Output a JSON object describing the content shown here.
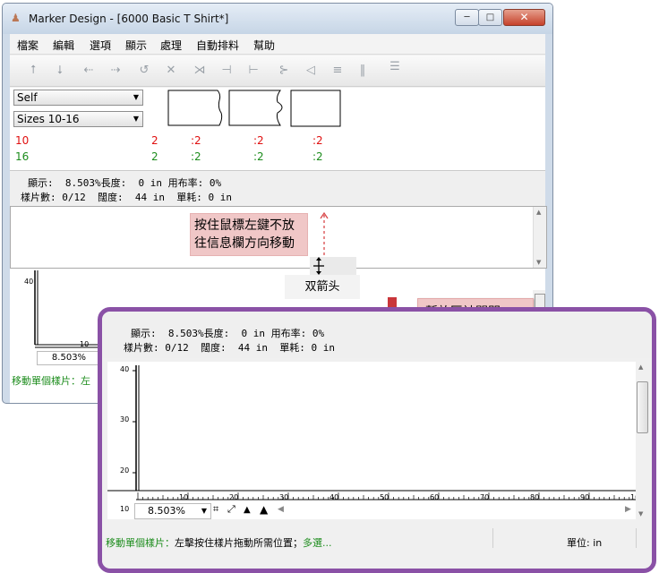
{
  "window": {
    "title": "Marker Design - [6000 Basic T Shirt*]",
    "min_glyph": "─",
    "max_glyph": "□",
    "close_glyph": "✕"
  },
  "menu": [
    "檔案",
    "編輯",
    "選項",
    "顯示",
    "處理",
    "自動排料",
    "幫助"
  ],
  "toolbar_icons": [
    "arrow-up-icon",
    "arrow-down-icon",
    "arrow-left-icon",
    "arrow-right-icon",
    "rotate-icon",
    "flip-vertical-icon",
    "flip-horizontal-icon",
    "align-left-icon",
    "align-right-icon",
    "split-icon",
    "notch-icon",
    "stack-icon",
    "bar-icon",
    "menu-lines-icon"
  ],
  "pieces": {
    "style_select": "Self",
    "size_select": "Sizes 10-16",
    "rows": [
      {
        "size": "10",
        "total": "2",
        "counts": [
          ":2",
          ":2",
          ":2"
        ],
        "color": "#e01010"
      },
      {
        "size": "16",
        "total": "2",
        "counts": [
          ":2",
          ":2",
          ":2"
        ],
        "color": "#1c8c1c"
      }
    ]
  },
  "info": {
    "line1": "顯示:  8.503%長度:  0 in 用布率: 0%",
    "line2": "樣片數: 0/12  闊度:  44 in  單耗: 0 in"
  },
  "annotations": {
    "drag_hint_line1": "按住鼠標左鍵不放",
    "drag_hint_line2": "往信息欄方向移動",
    "double_arrow": "双箭头",
    "closed_note": "暫放區被關閉"
  },
  "back_canvas": {
    "ytick": "40",
    "xtick": "10",
    "zoom": "8.503%",
    "status_left": "移動單個樣片：左"
  },
  "front": {
    "yticks": [
      "40",
      "30",
      "20",
      "10"
    ],
    "xticks": [
      "10",
      "20",
      "30",
      "40",
      "50",
      "60",
      "70",
      "80",
      "90",
      "100"
    ],
    "zoom": "8.503%",
    "status_left_green": "移動單個樣片：",
    "status_left_black": "左擊按住樣片拖動所需位置；",
    "status_left_green2": "多選...",
    "status_right": "單位: in"
  }
}
